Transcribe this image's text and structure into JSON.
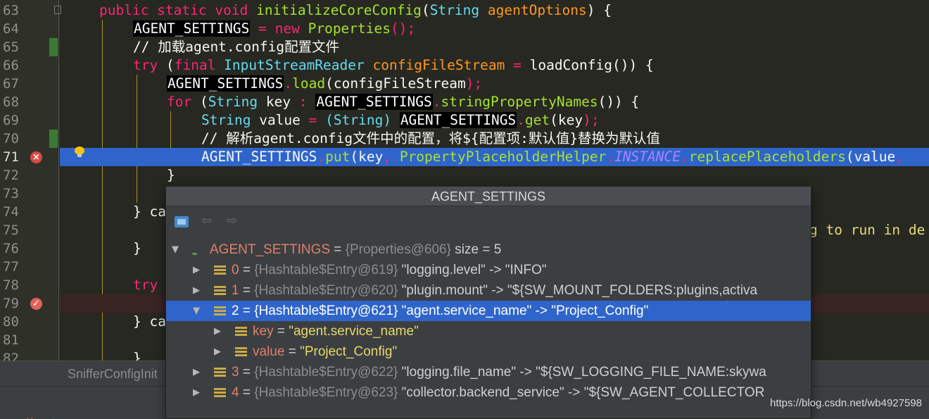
{
  "gutter": {
    "lines": [
      "63",
      "64",
      "65",
      "66",
      "67",
      "68",
      "69",
      "70",
      "71",
      "72",
      "73",
      "74",
      "75",
      "76",
      "77",
      "78",
      "79",
      "80",
      "81",
      "82"
    ]
  },
  "code": {
    "l63": {
      "kw1": "public",
      "kw2": "static",
      "kw3": "void",
      "fn": "initializeCoreConfig",
      "p1": "(",
      "ty": "String",
      "param": "agentOptions",
      "p2": ")",
      "brace": " {"
    },
    "l64": {
      "var": "AGENT_SETTINGS",
      "eq": " = ",
      "kw": "new",
      "cls": "Properties",
      "tail": "();"
    },
    "l65": {
      "comment": "// 加载agent.config配置文件"
    },
    "l66": {
      "kw1": "try",
      "p1": " (",
      "kw2": "final",
      "ty": "InputStreamReader",
      "var": "configFileStream",
      "eq": " = ",
      "fn": "loadConfig",
      "tail": "()) {"
    },
    "l67": {
      "var": "AGENT_SETTINGS",
      "dot": ".",
      "fn": "load",
      "p1": "(",
      "arg": "configFileStream",
      "tail": ");"
    },
    "l68": {
      "kw": "for",
      "p1": " (",
      "ty": "String",
      "key": "key",
      "colon": " : ",
      "var": "AGENT_SETTINGS",
      "dot": ".",
      "fn": "stringPropertyNames",
      "tail": "()) {"
    },
    "l69": {
      "ty": "String",
      "name": "value",
      "eq": " = ",
      "cast": "(String) ",
      "var": "AGENT_SETTINGS",
      "dot": ".",
      "fn": "get",
      "p1": "(",
      "arg": "key",
      "tail": ");"
    },
    "l70": {
      "comment": "// 解析agent.config文件中的配置，将${配置项:默认值}替换为默认值"
    },
    "l71": {
      "var": "AGENT_SETTINGS",
      "dot": ".",
      "fn": "put",
      "p1": "(",
      "arg1": "key",
      "comma": ", ",
      "cls": "PropertyPlaceholderHelper",
      "dot2": ".",
      "inst": "INSTANCE",
      "dot3": ".",
      "fn2": "replacePlaceholders",
      "p2": "(",
      "arg2": "value",
      "comma2": ","
    },
    "l72": {
      "brace": "}"
    },
    "l74": {
      "text": "} ca"
    },
    "l75": {
      "ghost": "g to run in de"
    },
    "l76": {
      "brace": "}"
    },
    "l78": {
      "kw": "try"
    },
    "l80": {
      "text": "} ca"
    },
    "l82": {
      "brace": "}"
    }
  },
  "popup": {
    "title": "AGENT_SETTINGS",
    "toolbar": {
      "back_icon": "arrow-left-icon",
      "forward_icon": "arrow-right-icon"
    },
    "root": {
      "name": "AGENT_SETTINGS",
      "eq": " = ",
      "type": "{Properties@606}",
      "extra": " size = 5"
    },
    "rows": [
      {
        "index": "0",
        "eq": " = ",
        "type": "{Hashtable$Entry@619}",
        "value": " \"logging.level\" -> \"INFO\""
      },
      {
        "index": "1",
        "eq": " = ",
        "type": "{Hashtable$Entry@620}",
        "value": " \"plugin.mount\" -> \"${SW_MOUNT_FOLDERS:plugins,activa"
      },
      {
        "index": "2",
        "eq": " = ",
        "type": "{Hashtable$Entry@621}",
        "value": " \"agent.service_name\" -> \"Project_Config\""
      },
      {
        "index": "3",
        "eq": " = ",
        "type": "{Hashtable$Entry@622}",
        "value": " \"logging.file_name\" -> \"${SW_LOGGING_FILE_NAME:skywa"
      },
      {
        "index": "4",
        "eq": " = ",
        "type": "{Hashtable$Entry@623}",
        "value": " \"collector.backend_service\" -> \"${SW_AGENT_COLLECTOR"
      }
    ],
    "children": [
      {
        "name": "key",
        "eq": " = ",
        "value": "\"agent.service_name\""
      },
      {
        "name": "value",
        "eq": " = ",
        "value": "\"Project_Config\""
      }
    ]
  },
  "bottom": {
    "tab_label": "SnifferConfigInit"
  },
  "watermark": "https://blog.csdn.net/wb4927598",
  "colors": {
    "selection": "#2f65ca",
    "keyword": "#f92672",
    "function": "#a6e22e",
    "type": "#66d9ef",
    "string": "#e6db74"
  }
}
